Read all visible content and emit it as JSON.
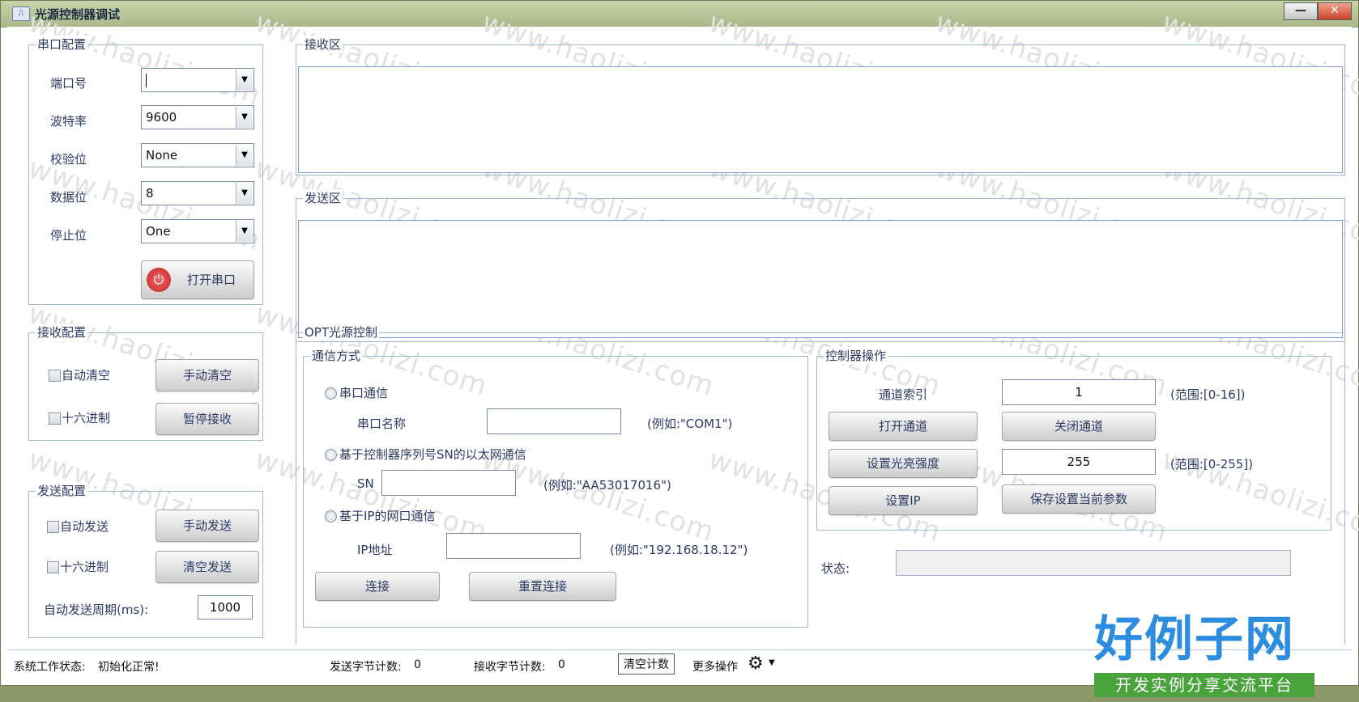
{
  "window": {
    "title": "光源控制器调试",
    "min_label": "—",
    "close_label": "✕"
  },
  "serial_config": {
    "legend": "串口配置",
    "port_label": "端口号",
    "port_value": "",
    "baud_label": "波特率",
    "baud_value": "9600",
    "parity_label": "校验位",
    "parity_value": "None",
    "databits_label": "数据位",
    "databits_value": "8",
    "stopbits_label": "停止位",
    "stopbits_value": "One",
    "open_button": "打开串口"
  },
  "receive_config": {
    "legend": "接收配置",
    "auto_clear": "自动清空",
    "manual_clear": "手动清空",
    "hex": "十六进制",
    "pause": "暂停接收"
  },
  "send_config": {
    "legend": "发送配置",
    "auto_send": "自动发送",
    "manual_send": "手动发送",
    "hex": "十六进制",
    "clear_send": "清空发送",
    "period_label": "自动发送周期(ms):",
    "period_value": "1000"
  },
  "receive_area": {
    "legend": "接收区"
  },
  "send_area": {
    "legend": "发送区"
  },
  "opt_control": {
    "legend": "OPT光源控制",
    "comm": {
      "legend": "通信方式",
      "serial_radio": "串口通信",
      "serial_name_label": "串口名称",
      "serial_name_value": "",
      "serial_example": "(例如:\"COM1\")",
      "sn_radio": "基于控制器序列号SN的以太网通信",
      "sn_label": "SN",
      "sn_value": "",
      "sn_example": "(例如:\"AA53017016\")",
      "ip_radio": "基于IP的网口通信",
      "ip_label": "IP地址",
      "ip_value": "",
      "ip_example": "(例如:\"192.168.18.12\")",
      "connect_button": "连接",
      "reconnect_button": "重置连接"
    },
    "ctrl": {
      "legend": "控制器操作",
      "channel_label": "通道索引",
      "channel_value": "1",
      "channel_range": "(范围:[0-16])",
      "open_channel": "打开通道",
      "close_channel": "关闭通道",
      "set_brightness": "设置光亮强度",
      "brightness_value": "255",
      "brightness_range": "(范围:[0-255])",
      "set_ip": "设置IP",
      "save_params": "保存设置当前参数"
    },
    "status_label": "状态:",
    "status_value": ""
  },
  "statusbar": {
    "system_label": "系统工作状态:",
    "system_value": "初始化正常!",
    "send_count_label": "发送字节计数:",
    "send_count": "0",
    "recv_count_label": "接收字节计数:",
    "recv_count": "0",
    "clear_count": "清空计数",
    "more_ops": "更多操作"
  },
  "watermark": "www.haolizi.com",
  "logo": {
    "main": "好例子网",
    "sub": "开发实例分享交流平台"
  }
}
